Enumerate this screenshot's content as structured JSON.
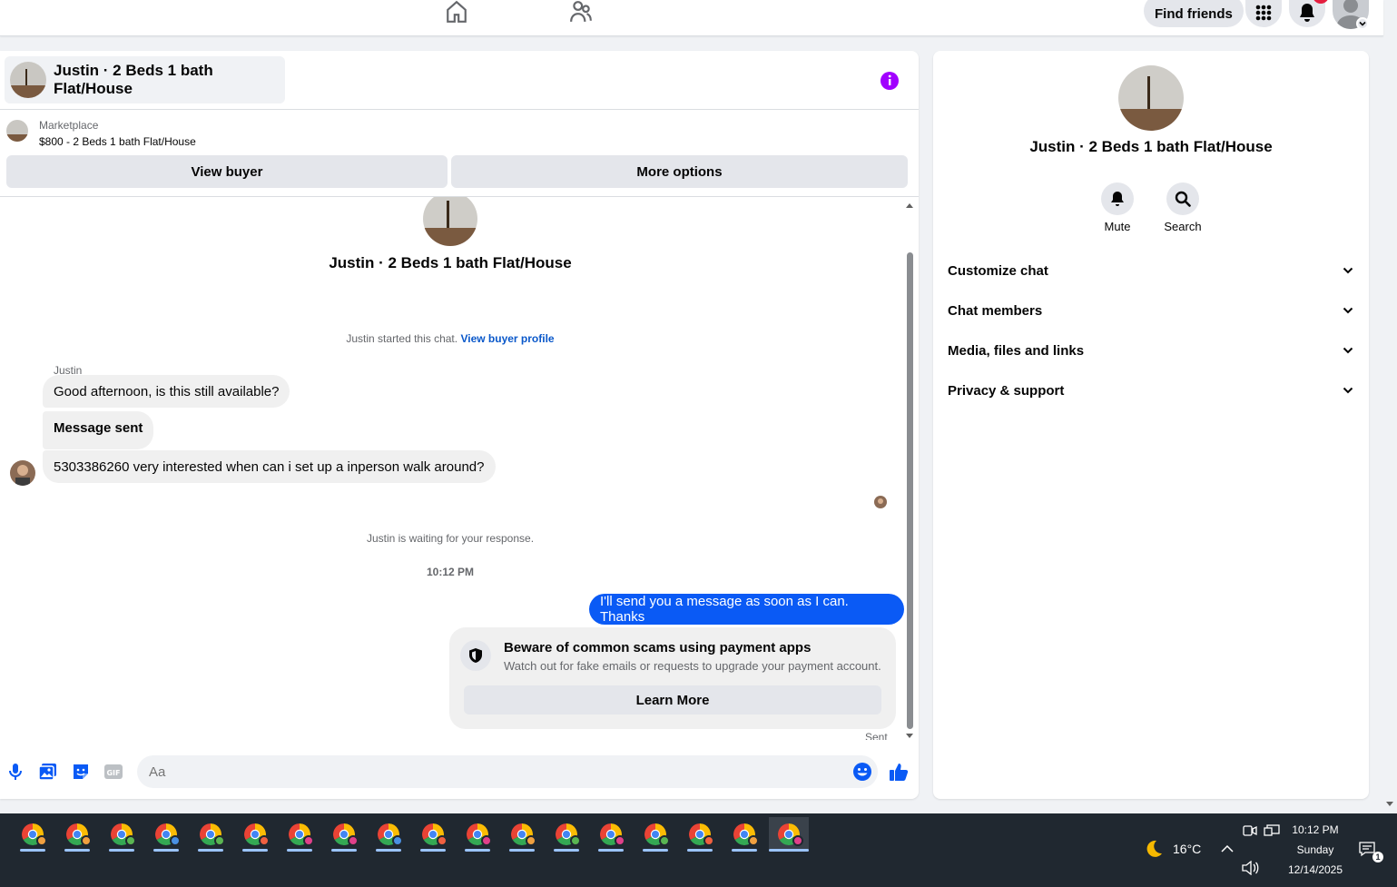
{
  "topnav": {
    "find_friends": "Find friends"
  },
  "chat": {
    "header_title": "Justin · 2 Beds 1 bath Flat/House",
    "marketplace_label": "Marketplace",
    "listing": "$800 - 2 Beds 1 bath Flat/House",
    "view_buyer": "View buyer",
    "more_options": "More options",
    "thread_title": "Justin · 2 Beds 1 bath Flat/House",
    "started_text": "Justin started this chat.",
    "view_buyer_profile": "View buyer profile",
    "sender_name": "Justin",
    "messages_in": [
      "Good afternoon, is this still available?",
      "Message sent",
      "5303386260 very interested when can i set up a inperson walk around?"
    ],
    "waiting_text": "Justin is waiting for your response.",
    "timestamp": "10:12 PM",
    "message_out": "I'll send you a message as soon as I can. Thanks",
    "scam_title": "Beware of common scams using payment apps",
    "scam_desc": "Watch out for fake emails or requests to upgrade your payment account.",
    "learn_more": "Learn More",
    "sent_label": "Sent",
    "composer_placeholder": "Aa"
  },
  "info_panel": {
    "title": "Justin · 2 Beds 1 bath Flat/House",
    "mute": "Mute",
    "search": "Search",
    "sections": [
      "Customize chat",
      "Chat members",
      "Media, files and links",
      "Privacy & support"
    ]
  },
  "taskbar": {
    "temperature": "16°C",
    "time": "10:12 PM",
    "day": "Sunday",
    "date": "12/14/2025",
    "notif_count": "1",
    "profile_colors": [
      "#f0a040",
      "#f0a040",
      "#5ab552",
      "#4a90e2",
      "#5ab552",
      "#f06040",
      "#e0408a",
      "#e0408a",
      "#4a90e2",
      "#f06040",
      "#e0408a",
      "#f0a040",
      "#5ab552",
      "#e0408a",
      "#5ab552",
      "#f06040",
      "#f0a040",
      "#e0408a"
    ]
  },
  "colors": {
    "accent": "#0a5af5",
    "info_purple": "#a100ff"
  }
}
